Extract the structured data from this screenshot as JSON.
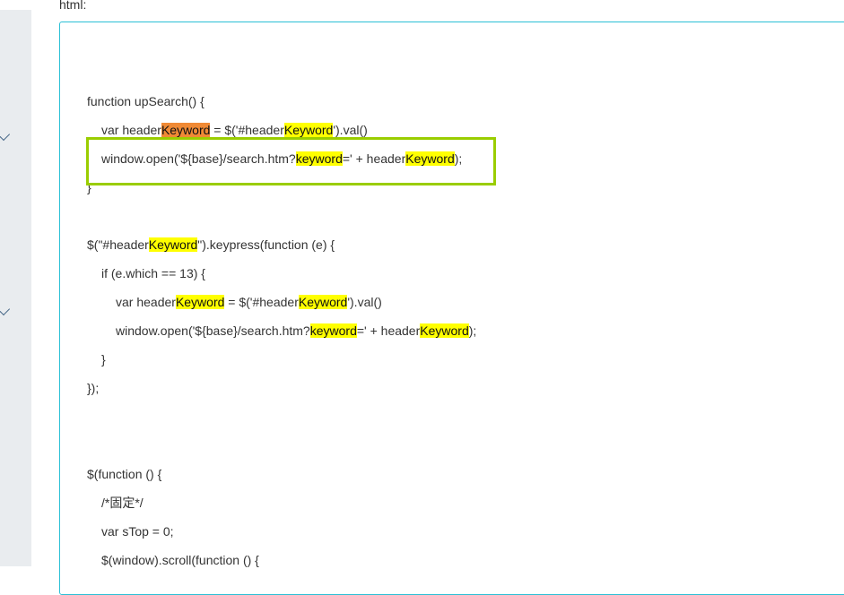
{
  "label": "html:",
  "sidebar": {
    "chevrons": [
      "chevron-down-icon",
      "chevron-down-icon"
    ]
  },
  "colors": {
    "highlight": "#ffff00",
    "current_match": "#f08a35",
    "annotation": "#9acd00",
    "box_border": "#2bc0d6"
  },
  "code_lines": [
    {
      "indent": 0,
      "parts": [
        {
          "t": "function upSearch() {"
        }
      ]
    },
    {
      "indent": 1,
      "parts": [
        {
          "t": "var header"
        },
        {
          "t": "Keyword",
          "hl": "orange"
        },
        {
          "t": " = $('#header"
        },
        {
          "t": "Keyword",
          "hl": "yellow"
        },
        {
          "t": "').val()"
        }
      ]
    },
    {
      "indent": 1,
      "parts": [
        {
          "t": "window.open('${base}/search.htm?"
        },
        {
          "t": "keyword",
          "hl": "yellow"
        },
        {
          "t": "=' + header"
        },
        {
          "t": "Keyword",
          "hl": "yellow"
        },
        {
          "t": ");"
        }
      ]
    },
    {
      "indent": 0,
      "parts": [
        {
          "t": "}"
        }
      ]
    },
    {
      "indent": 0,
      "parts": []
    },
    {
      "indent": 0,
      "parts": [
        {
          "t": "$(\"#header"
        },
        {
          "t": "Keyword",
          "hl": "yellow"
        },
        {
          "t": "\").keypress(function (e) {"
        }
      ]
    },
    {
      "indent": 1,
      "parts": [
        {
          "t": "if (e.which == 13) {"
        }
      ]
    },
    {
      "indent": 2,
      "parts": [
        {
          "t": "var header"
        },
        {
          "t": "Keyword",
          "hl": "yellow"
        },
        {
          "t": " = $('#header"
        },
        {
          "t": "Keyword",
          "hl": "yellow"
        },
        {
          "t": "').val()"
        }
      ]
    },
    {
      "indent": 2,
      "parts": [
        {
          "t": "window.open('${base}/search.htm?"
        },
        {
          "t": "keyword",
          "hl": "yellow"
        },
        {
          "t": "=' + header"
        },
        {
          "t": "Keyword",
          "hl": "yellow"
        },
        {
          "t": ");"
        }
      ]
    },
    {
      "indent": 1,
      "parts": [
        {
          "t": "}"
        }
      ]
    },
    {
      "indent": 0,
      "parts": [
        {
          "t": "});"
        }
      ]
    },
    {
      "indent": 0,
      "parts": []
    },
    {
      "indent": 0,
      "parts": []
    },
    {
      "indent": 0,
      "parts": [
        {
          "t": "$(function () {"
        }
      ]
    },
    {
      "indent": 1,
      "parts": [
        {
          "t": "/*固定*/"
        }
      ]
    },
    {
      "indent": 1,
      "parts": [
        {
          "t": "var sTop = 0;"
        }
      ]
    },
    {
      "indent": 1,
      "parts": [
        {
          "t": "$(window).scroll(function () {"
        }
      ]
    }
  ]
}
